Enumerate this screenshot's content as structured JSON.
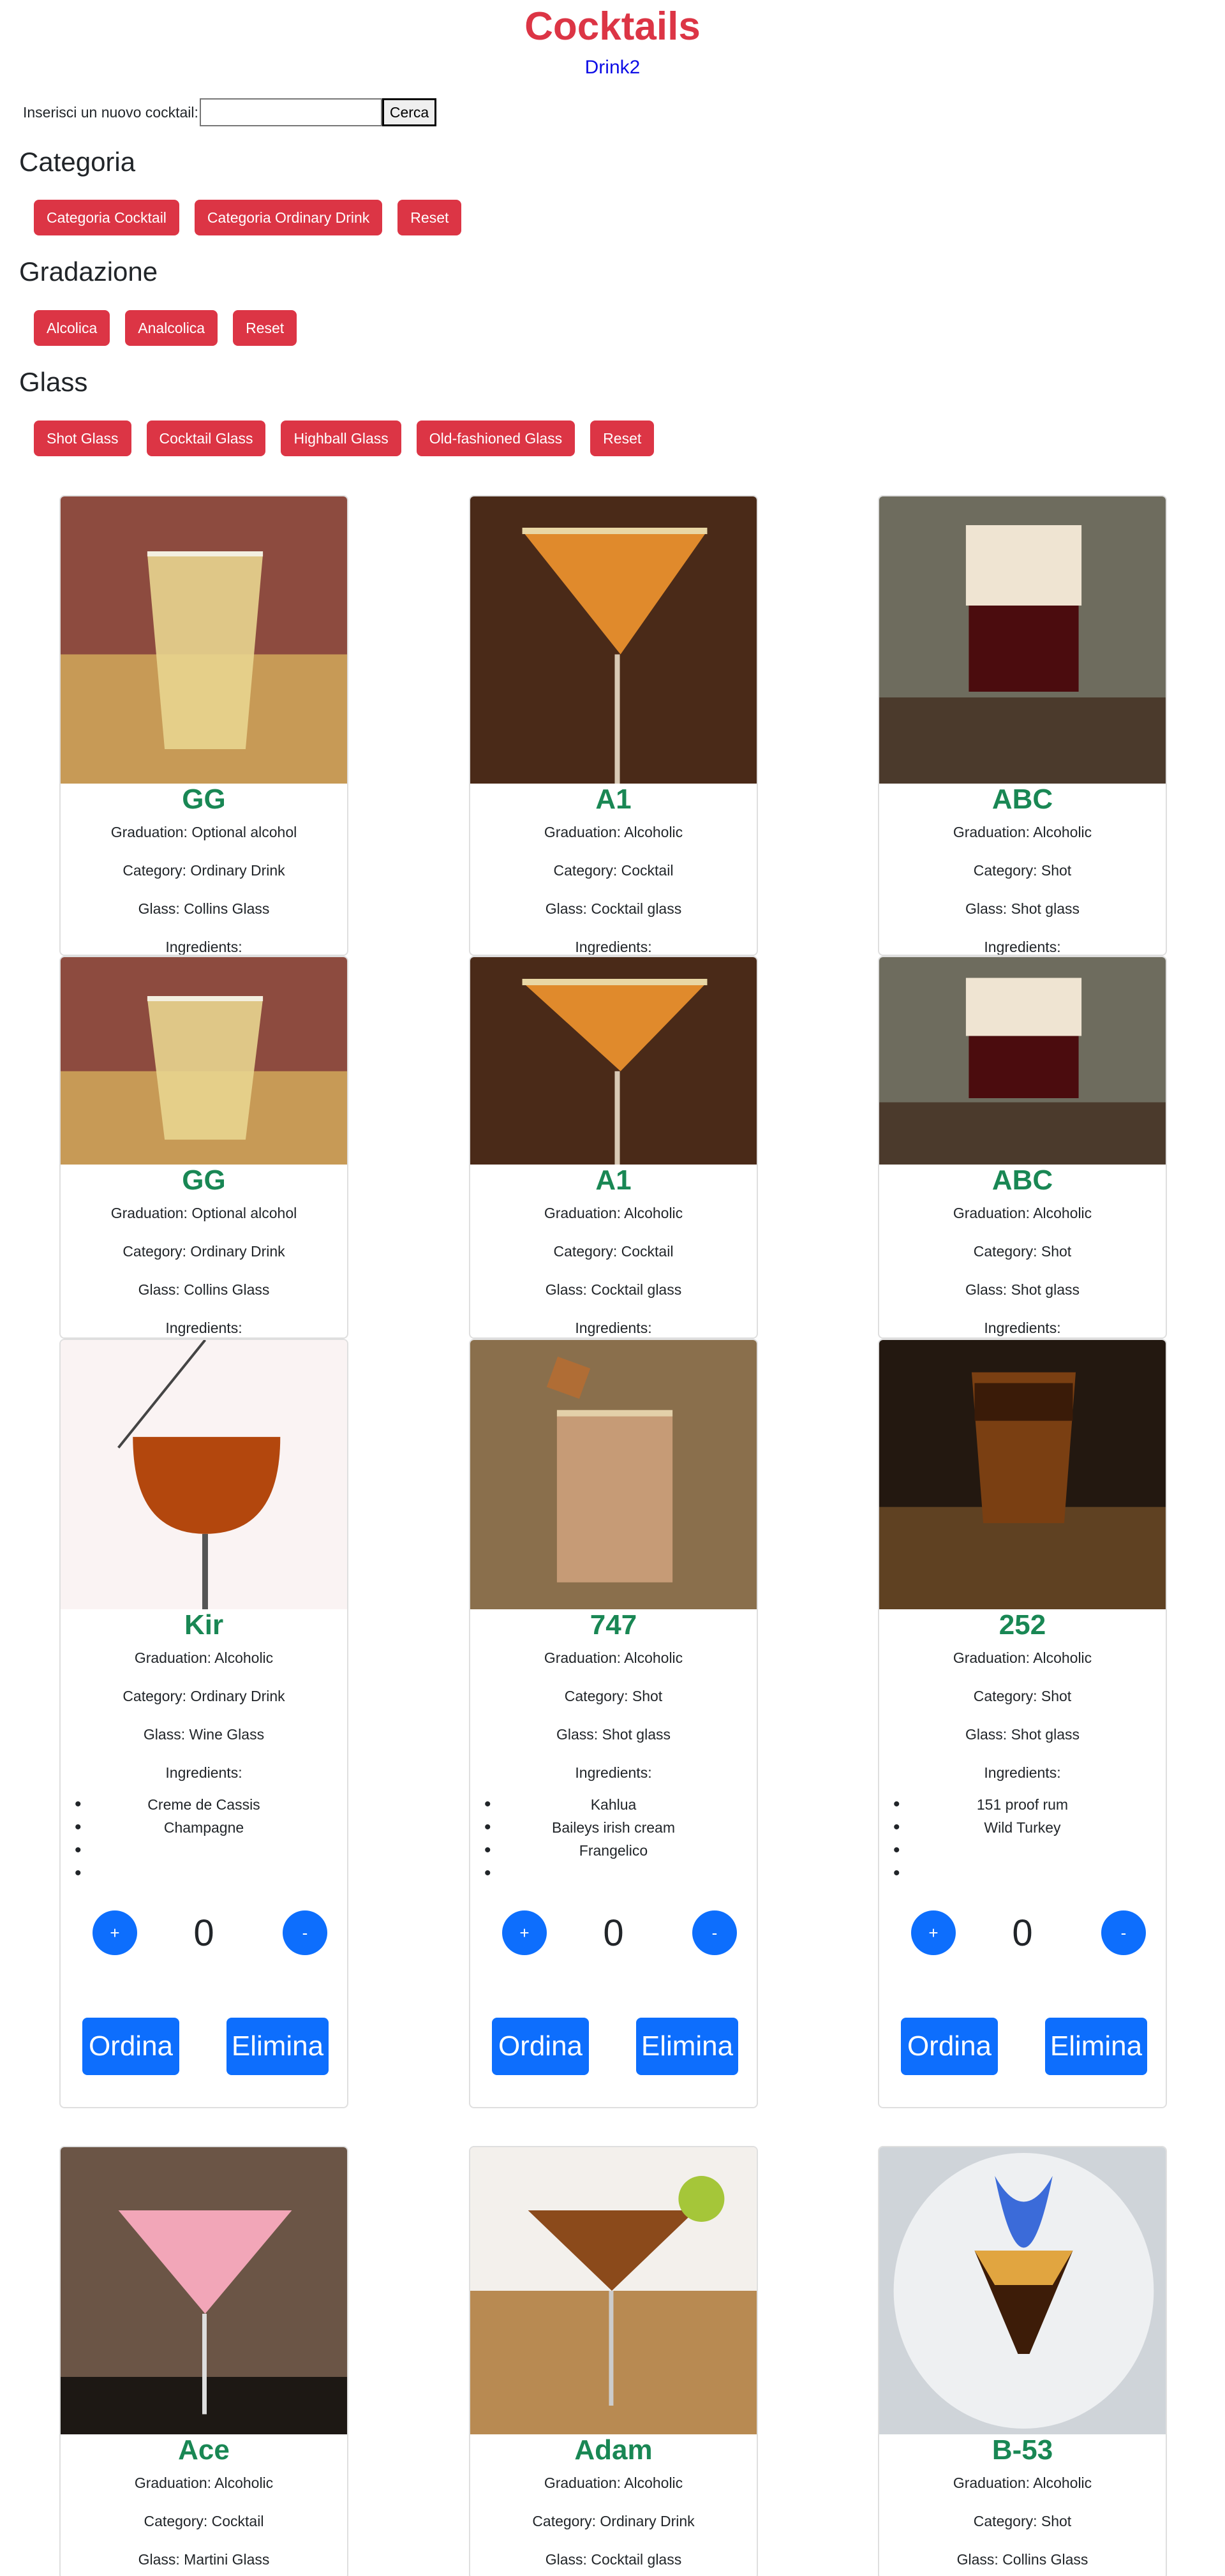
{
  "header": {
    "title": "Cocktails",
    "subtitle": "Drink2"
  },
  "search": {
    "label": "Inserisci un nuovo cocktail:",
    "value": "",
    "placeholder": "",
    "button": "Cerca"
  },
  "filters": {
    "categoria": {
      "title": "Categoria",
      "buttons": [
        "Categoria Cocktail",
        "Categoria Ordinary Drink",
        "Reset"
      ]
    },
    "gradazione": {
      "title": "Gradazione",
      "buttons": [
        "Alcolica",
        "Analcolica",
        "Reset"
      ]
    },
    "glass": {
      "title": "Glass",
      "buttons": [
        "Shot Glass",
        "Cocktail Glass",
        "Highball Glass",
        "Old-fashioned Glass",
        "Reset"
      ]
    }
  },
  "cards": [
    {
      "name": "GG",
      "graduation": "Graduation: Optional alcohol",
      "category": "Category: Ordinary Drink",
      "glass": "Glass: Collins Glass",
      "ingredients_label": "Ingredients:",
      "image": "gg-glass-photo"
    },
    {
      "name": "A1",
      "graduation": "Graduation: Alcoholic",
      "category": "Category: Cocktail",
      "glass": "Glass: Cocktail glass",
      "ingredients_label": "Ingredients:",
      "image": "a1-martini-photo"
    },
    {
      "name": "ABC",
      "graduation": "Graduation: Alcoholic",
      "category": "Category: Shot",
      "glass": "Glass: Shot glass",
      "ingredients_label": "Ingredients:",
      "image": "abc-shot-photo"
    },
    {
      "name": "GG",
      "graduation": "Graduation: Optional alcohol",
      "category": "Category: Ordinary Drink",
      "glass": "Glass: Collins Glass",
      "ingredients_label": "Ingredients:",
      "image": "gg-glass-photo"
    },
    {
      "name": "A1",
      "graduation": "Graduation: Alcoholic",
      "category": "Category: Cocktail",
      "glass": "Glass: Cocktail glass",
      "ingredients_label": "Ingredients:",
      "image": "a1-martini-photo"
    },
    {
      "name": "ABC",
      "graduation": "Graduation: Alcoholic",
      "category": "Category: Shot",
      "glass": "Glass: Shot glass",
      "ingredients_label": "Ingredients:",
      "image": "abc-shot-photo"
    },
    {
      "name": "Kir",
      "graduation": "Graduation: Alcoholic",
      "category": "Category: Ordinary Drink",
      "glass": "Glass: Wine Glass",
      "ingredients_label": "Ingredients:",
      "ingredients": [
        "Creme de Cassis",
        "Champagne",
        "",
        ""
      ],
      "quantity": "0",
      "plus": "+",
      "minus": "-",
      "order": "Ordina",
      "delete": "Elimina",
      "image": "kir-wine-photo"
    },
    {
      "name": "747",
      "graduation": "Graduation: Alcoholic",
      "category": "Category: Shot",
      "glass": "Glass: Shot glass",
      "ingredients_label": "Ingredients:",
      "ingredients": [
        "Kahlua",
        "Baileys irish cream",
        "Frangelico",
        ""
      ],
      "quantity": "0",
      "plus": "+",
      "minus": "-",
      "order": "Ordina",
      "delete": "Elimina",
      "image": "747-shot-photo"
    },
    {
      "name": "252",
      "graduation": "Graduation: Alcoholic",
      "category": "Category: Shot",
      "glass": "Glass: Shot glass",
      "ingredients_label": "Ingredients:",
      "ingredients": [
        "151 proof rum",
        "Wild Turkey",
        "",
        ""
      ],
      "quantity": "0",
      "plus": "+",
      "minus": "-",
      "order": "Ordina",
      "delete": "Elimina",
      "image": "252-shot-photo"
    },
    {
      "name": "Ace",
      "graduation": "Graduation: Alcoholic",
      "category": "Category: Cocktail",
      "glass": "Glass: Martini Glass",
      "image": "ace-martini-photo"
    },
    {
      "name": "Adam",
      "graduation": "Graduation: Alcoholic",
      "category": "Category: Ordinary Drink",
      "glass": "Glass: Cocktail glass",
      "image": "adam-cocktail-photo"
    },
    {
      "name": "B-53",
      "graduation": "Graduation: Alcoholic",
      "category": "Category: Shot",
      "glass": "Glass: Collins Glass",
      "image": "b53-flaming-photo"
    }
  ],
  "colors": {
    "accent_red": "#dc3545",
    "button_blue": "#0d6efd",
    "name_green": "#198754",
    "link_blue": "#0d0de6"
  }
}
